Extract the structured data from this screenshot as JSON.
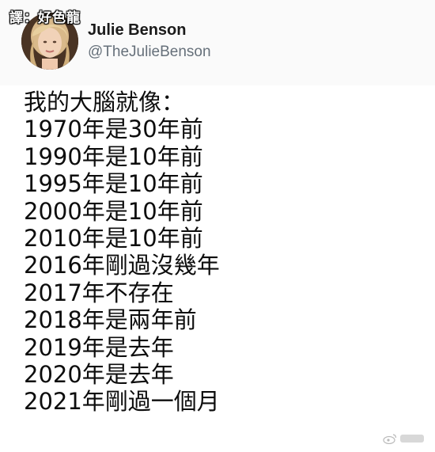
{
  "translator_credit": "譯：好色龍",
  "author": {
    "name": "Julie Benson",
    "handle": "@TheJulieBenson",
    "avatar_icon": "profile-photo"
  },
  "tweet_lines": [
    "我的大腦就像：",
    "1970年是30年前",
    "1990年是10年前",
    "1995年是10年前",
    "2000年是10年前",
    "2010年是10年前",
    "2016年剛過沒幾年",
    "2017年不存在",
    "2018年是兩年前",
    "2019年是去年",
    "2020年是去年",
    "2021年剛過一個月"
  ],
  "watermark": {
    "icon": "weibo-icon"
  },
  "colors": {
    "text": "#0d0d0d",
    "handle": "#66707a",
    "header_bg": "#fafafa"
  }
}
